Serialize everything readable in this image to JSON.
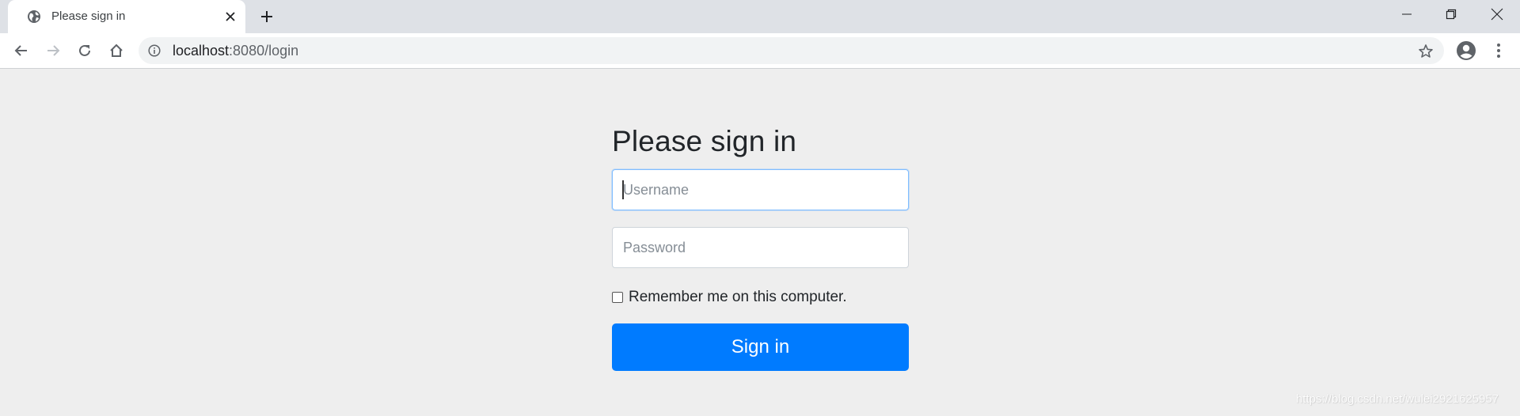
{
  "browser": {
    "tab": {
      "title": "Please sign in",
      "favicon": "globe-icon",
      "close_icon": "close-icon"
    },
    "new_tab_icon": "plus-icon",
    "window_controls": [
      "minimize-icon",
      "restore-icon",
      "close-icon"
    ],
    "toolbar": {
      "back_icon": "arrow-left-icon",
      "forward_icon": "arrow-right-icon",
      "reload_icon": "reload-icon",
      "home_icon": "home-icon",
      "address": {
        "info_icon": "info-icon",
        "host": "localhost",
        "path": ":8080/login",
        "bookmark_icon": "star-icon"
      },
      "profile_icon": "account-circle-icon",
      "menu_icon": "kebab-menu-icon"
    }
  },
  "page": {
    "heading": "Please sign in",
    "username": {
      "value": "",
      "placeholder": "Username",
      "focused": true
    },
    "password": {
      "value": "",
      "placeholder": "Password"
    },
    "remember_me": {
      "label": "Remember me on this computer.",
      "checked": false
    },
    "submit_label": "Sign in",
    "colors": {
      "primary": "#007bff",
      "focus_border": "#80bdff",
      "background": "#eeeeee"
    }
  },
  "watermark": "https://blog.csdn.net/wulei2921625957"
}
